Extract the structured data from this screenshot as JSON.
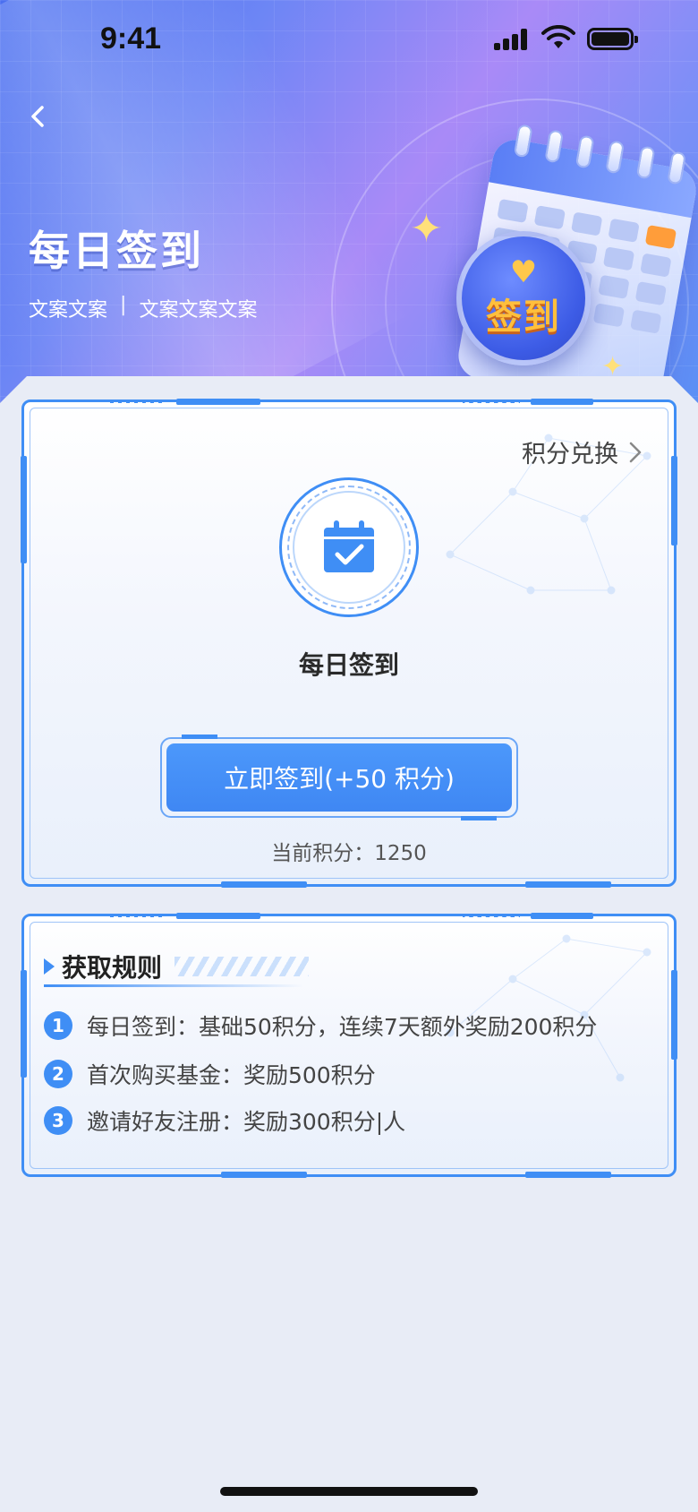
{
  "status_bar": {
    "time": "9:41"
  },
  "header": {
    "title": "每日签到",
    "subtitle_left": "文案文案",
    "subtitle_sep": "|",
    "subtitle_right": "文案文案文案",
    "illustration_text": "签到"
  },
  "checkin_card": {
    "exchange_label": "积分兑换",
    "title": "每日签到",
    "button_label": "立即签到(+50 积分)",
    "points_text": "当前积分：1250"
  },
  "rules_card": {
    "title": "获取规则",
    "items": [
      {
        "num": "1",
        "text": "每日签到：基础50积分，连续7天额外奖励200积分"
      },
      {
        "num": "2",
        "text": "首次购买基金：奖励500积分"
      },
      {
        "num": "3",
        "text": "邀请好友注册：奖励300积分|人"
      }
    ]
  },
  "colors": {
    "accent": "#3f8ef5",
    "hero_start": "#4a6ff0",
    "hero_mid": "#a98af7",
    "badge_text": "#ffbf3c"
  }
}
